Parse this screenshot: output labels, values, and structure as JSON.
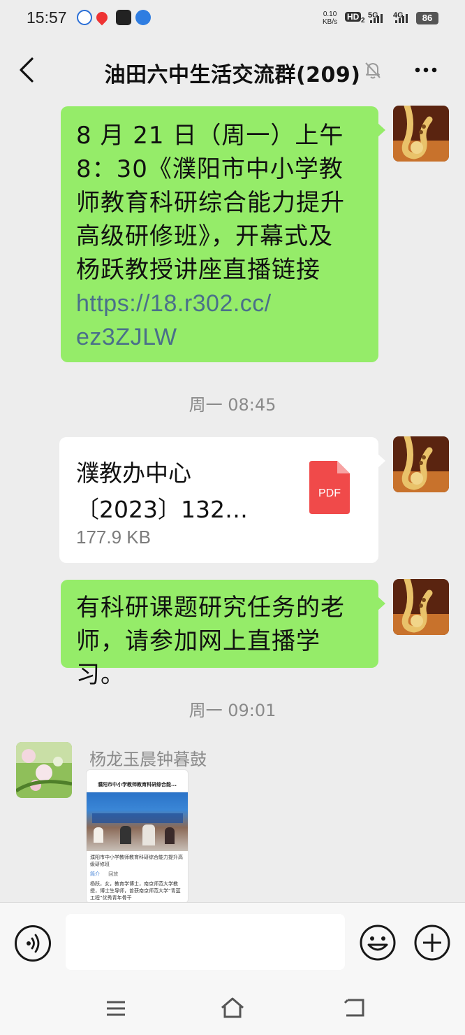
{
  "status_bar": {
    "time": "15:57",
    "net_speed_value": "0.10",
    "net_speed_unit": "KB/s",
    "hd_label": "HD",
    "hd_sub": "2",
    "signal1": "5G",
    "signal2": "4G",
    "battery": "86"
  },
  "header": {
    "title": "油田六中生活交流群(209)"
  },
  "messages": [
    {
      "text": "8 月 21 日（周一）上午\n8：30《濮阳市中小学教\n师教育科研综合能力提升\n高级研修班》，开幕式及\n杨跃教授讲座直播链接",
      "link": "https://18.r302.cc/\nez3ZJLW"
    },
    {
      "timestamp": "周一 08:45"
    },
    {
      "file_name": "濮教办中心\n〔2023〕132…",
      "file_size": "177.9 KB",
      "file_type": "PDF"
    },
    {
      "text": "有科研课题研究任务的老\n师，请参加网上直播学习。"
    },
    {
      "timestamp": "周一 09:01"
    },
    {
      "sender": "杨龙玉晨钟暮鼓",
      "shot_title": "濮阳市中小学教师教育科研综合能...",
      "shot_heading": "濮阳市中小学教师教育科研综合能力提升高级研修班",
      "shot_tab1": "简介",
      "shot_tab2": "回放",
      "shot_body": "杨跃，女，教育学博士，南京师范大学教授，博士生导师，曾获南京师范大学“青蓝工程”优秀青年骨干"
    }
  ],
  "input": {
    "value": ""
  },
  "colors": {
    "self_bubble": "#95ec69",
    "link": "#4a6f8a",
    "pdf_red": "#f04a4a"
  }
}
